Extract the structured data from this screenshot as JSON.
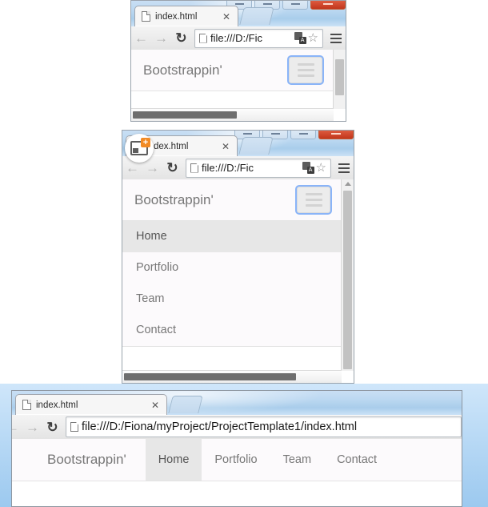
{
  "meta": {
    "description": "Three stacked Google Chrome browser windows at different widths showing a responsive Bootstrap navbar demo page."
  },
  "colors": {
    "titlebar_blue": "#bcd8f1",
    "close_button_red": "#d9553a",
    "focus_ring_blue": "#8ab4f8",
    "active_nav_gray": "#e7e7e7",
    "nav_text_gray": "#777777",
    "page_background": "#fcfafc",
    "drag_badge_orange": "#f28b25"
  },
  "windows": [
    {
      "id": "window-narrow-collapsed",
      "window_controls": [
        {
          "name": "minimize-button",
          "glyph": "–"
        },
        {
          "name": "maximize-button",
          "glyph": "□"
        },
        {
          "name": "restore-button",
          "glyph": "□"
        },
        {
          "name": "close-button",
          "glyph": "✕"
        }
      ],
      "tab": {
        "title": "index.html",
        "close_label": "✕",
        "favicon": "page-icon"
      },
      "new_tab_label": "+",
      "toolbar": {
        "back_label": "←",
        "forward_label": "→",
        "reload_label": "↻",
        "url": "file:///D:/Fic",
        "translate_icon": "translate-icon",
        "translate_glyph": "A",
        "bookmark_label": "☆",
        "menu_label": "menu-icon"
      },
      "page": {
        "brand": "Bootstrappin'",
        "toggle_label": "navbar-toggle",
        "menu_open": false,
        "menu_items": []
      }
    },
    {
      "id": "window-narrow-expanded",
      "window_controls": [
        {
          "name": "minimize-button",
          "glyph": "–"
        },
        {
          "name": "maximize-button",
          "glyph": "□"
        },
        {
          "name": "restore-button",
          "glyph": "□"
        },
        {
          "name": "close-button",
          "glyph": "✕"
        }
      ],
      "tab": {
        "title": "index.html",
        "close_label": "✕",
        "favicon": "page-icon"
      },
      "new_tab_label": "+",
      "drag_cursor": {
        "name": "drag-new-window-cursor",
        "badge": "+"
      },
      "toolbar": {
        "back_label": "←",
        "forward_label": "→",
        "reload_label": "↻",
        "url": "file:///D:/Fic",
        "translate_icon": "translate-icon",
        "translate_glyph": "A",
        "bookmark_label": "☆",
        "menu_label": "menu-icon"
      },
      "page": {
        "brand": "Bootstrappin'",
        "toggle_label": "navbar-toggle",
        "menu_open": true,
        "menu_items": [
          {
            "label": "Home",
            "active": true
          },
          {
            "label": "Portfolio",
            "active": false
          },
          {
            "label": "Team",
            "active": false
          },
          {
            "label": "Contact",
            "active": false
          }
        ]
      }
    },
    {
      "id": "window-wide",
      "tab": {
        "title": "index.html",
        "close_label": "✕",
        "favicon": "page-icon"
      },
      "new_tab_label": "+",
      "toolbar": {
        "back_label": "←",
        "forward_label": "→",
        "reload_label": "↻",
        "url": "file:///D:/Fiona/myProject/ProjectTemplate1/index.html"
      },
      "page": {
        "brand": "Bootstrappin'",
        "menu_open": true,
        "menu_items": [
          {
            "label": "Home",
            "active": true
          },
          {
            "label": "Portfolio",
            "active": false
          },
          {
            "label": "Team",
            "active": false
          },
          {
            "label": "Contact",
            "active": false
          }
        ]
      }
    }
  ]
}
